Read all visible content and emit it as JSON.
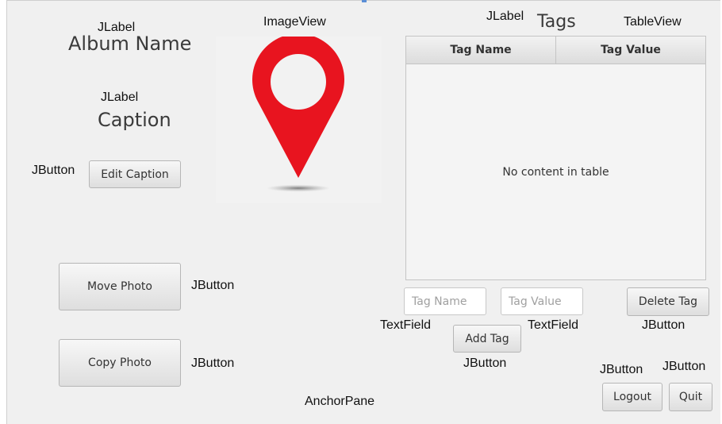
{
  "annotations": {
    "album_name_type": "JLabel",
    "image_view_type": "ImageView",
    "tags_label_type": "JLabel",
    "table_type": "TableView",
    "caption_type": "JLabel",
    "edit_caption_type": "JButton",
    "move_photo_type": "JButton",
    "copy_photo_type": "JButton",
    "tag_name_field_type": "TextField",
    "tag_value_field_type": "TextField",
    "delete_tag_type": "JButton",
    "add_tag_type": "JButton",
    "logout_type": "JButton",
    "quit_type": "JButton",
    "container_type": "AnchorPane"
  },
  "labels": {
    "album_name": "Album Name",
    "caption": "Caption",
    "tags": "Tags"
  },
  "buttons": {
    "edit_caption": "Edit Caption",
    "move_photo": "Move Photo",
    "copy_photo": "Copy Photo",
    "add_tag": "Add Tag",
    "delete_tag": "Delete Tag",
    "logout": "Logout",
    "quit": "Quit"
  },
  "fields": {
    "tag_name_placeholder": "Tag Name",
    "tag_value_placeholder": "Tag Value"
  },
  "table": {
    "columns": [
      "Tag Name",
      "Tag Value"
    ],
    "empty_message": "No content in table"
  },
  "image": {
    "icon": "map-pin-icon",
    "pin_color": "#e8141f"
  }
}
